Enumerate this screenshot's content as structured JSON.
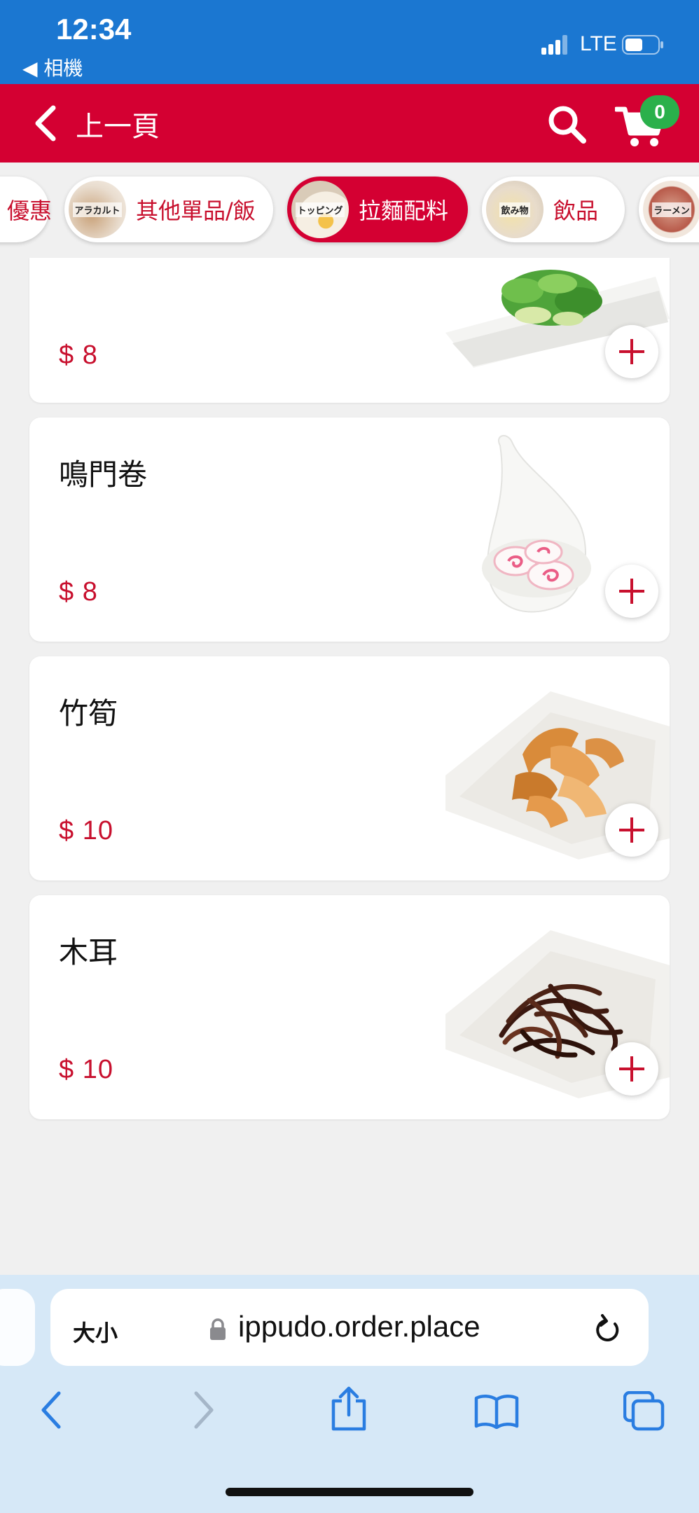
{
  "status_bar": {
    "time": "12:34",
    "back_app": "◀ 相機",
    "network": "LTE",
    "colors": {
      "background": "#1b77d1"
    }
  },
  "header": {
    "back_label": "上一頁",
    "cart_count": "0",
    "icons": [
      "chevron-left-icon",
      "search-icon",
      "cart-icon"
    ],
    "colors": {
      "background": "#d40032",
      "badge": "#2ab04b"
    }
  },
  "categories": [
    {
      "label": "優惠",
      "thumb_text": "",
      "active": false
    },
    {
      "label": "其他單品/飯",
      "thumb_text": "アラカルト",
      "active": false
    },
    {
      "label": "拉麵配料",
      "thumb_text": "トッピング",
      "active": true
    },
    {
      "label": "飲品",
      "thumb_text": "飲み物",
      "active": false
    },
    {
      "label": "",
      "thumb_text": "ラーメン",
      "active": false
    }
  ],
  "menu_items": [
    {
      "name": "",
      "price": "$ 8",
      "photo": "green-onion"
    },
    {
      "name": "鳴門卷",
      "price": "$ 8",
      "photo": "narutomaki"
    },
    {
      "name": "竹筍",
      "price": "$ 10",
      "photo": "bamboo-shoots"
    },
    {
      "name": "木耳",
      "price": "$ 10",
      "photo": "wood-ear-mushroom"
    }
  ],
  "safari": {
    "text_size_label": "大小",
    "url": "ippudo.order.place",
    "icons": [
      "lock-icon",
      "reload-icon",
      "back-icon",
      "forward-icon",
      "share-icon",
      "bookmarks-icon",
      "tabs-icon"
    ]
  }
}
